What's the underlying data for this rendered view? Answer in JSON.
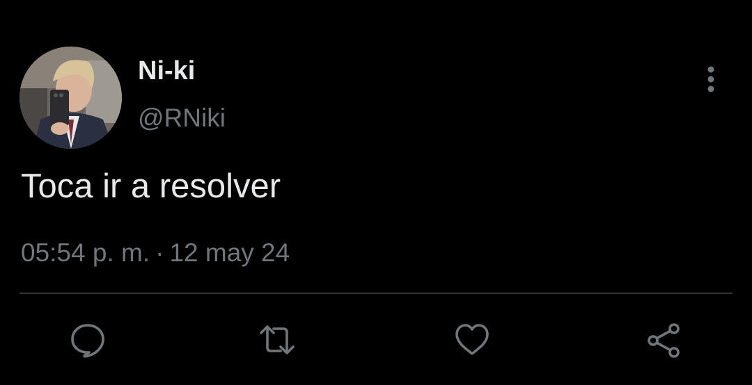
{
  "tweet": {
    "author": {
      "display_name": "Ni-ki",
      "handle": "@RNiki",
      "avatar_icon": "profile-photo"
    },
    "text": "Toca ir a resolver",
    "time": "05:54 p. m.",
    "separator": "·",
    "date": "12 may 24"
  },
  "actions": [
    {
      "name": "reply",
      "icon": "speech-bubble-icon"
    },
    {
      "name": "retweet",
      "icon": "retweet-icon"
    },
    {
      "name": "like",
      "icon": "heart-icon"
    },
    {
      "name": "share",
      "icon": "share-icon"
    }
  ],
  "colors": {
    "background": "#000000",
    "primary_text": "#e7e9ea",
    "secondary_text": "#71767b",
    "divider": "#2f3336"
  }
}
